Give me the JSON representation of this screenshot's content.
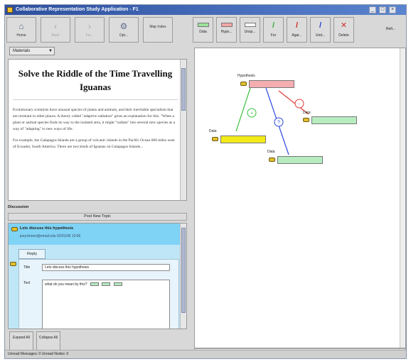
{
  "window": {
    "title": "Collaborative Representation Study Application - F1",
    "controls": {
      "minimize": "_",
      "maximize": "□",
      "close": "×"
    }
  },
  "toolbar": {
    "items": [
      {
        "label": "Home",
        "icon": "house-icon",
        "glyph": "⌂",
        "enabled": true
      },
      {
        "label": "Back",
        "icon": "back-arrow-icon",
        "glyph": "‹",
        "enabled": false
      },
      {
        "label": "Fw...",
        "icon": "forward-arrow-icon",
        "glyph": "›",
        "enabled": false
      },
      {
        "label": "Opt...",
        "icon": "options-icon",
        "glyph": "⚙",
        "enabled": true
      },
      {
        "label": "Map Index",
        "icon": "map-index-icon",
        "glyph": "",
        "enabled": true
      }
    ]
  },
  "selector": {
    "value": "Materials",
    "arrow": "▼"
  },
  "reading": {
    "title": "Solve the Riddle of the Time Travelling Iguanas",
    "paragraphs": [
      "Evolutionary scientists have unusual species of plants and animals, and their inevitable specialism that are resistant in other places. A theory called \"adaptive radiation\" gives an explanation for this. \"When a plant or animal species finds its way to the isolated area, it might \"radiate\" into several new species as a way of \"adapting\" to new ways of life.",
      "For example, the Galapagos Islands are a group of volcanic islands in the Pacific Ocean 600 miles west of Ecuador, South America. There are two kinds of Iguanas on Galapagos Islands..."
    ]
  },
  "discussion": {
    "label": "Discussion",
    "post_new": "Post New Topic",
    "message": {
      "title": "Lets discuss this hypothesis",
      "meta": "joey.brown@email.edu 02/01/06 10:56"
    },
    "reply_tab": "Reply",
    "title_label": "Title",
    "title_value": "Lets discuss this hypothesis",
    "text_label": "Text",
    "text_value": "what do you mean by this?",
    "expand": "Expand All",
    "collapse": "Collapse All"
  },
  "status": "Unread Messages: 0  Unread Nodes: 0",
  "graph_toolbar": {
    "items": [
      {
        "label": "Data",
        "swatch": "#9be39b",
        "icon": "data-node-icon"
      },
      {
        "label": "Hypo...",
        "swatch": "#f4a6a6",
        "icon": "hypothesis-node-icon"
      },
      {
        "label": "Unsp...",
        "swatch": "#ffffff",
        "icon": "unspecified-node-icon"
      },
      {
        "label": "For",
        "glyph": "/",
        "glyph_color": "#2eaa2e",
        "icon": "for-link-icon"
      },
      {
        "label": "Agai...",
        "glyph": "/",
        "glyph_color": "#d02020",
        "icon": "against-link-icon"
      },
      {
        "label": "Und...",
        "glyph": "/",
        "glyph_color": "#2040d0",
        "icon": "undetermined-link-icon"
      },
      {
        "label": "Delete",
        "glyph": "✕",
        "glyph_color": "#d03030",
        "icon": "delete-icon"
      }
    ],
    "extra": "Refr..."
  },
  "graph": {
    "nodes": [
      {
        "id": "hyp",
        "type": "Hypothesis",
        "fill": "#f5aeb0"
      },
      {
        "id": "data1",
        "type": "Data",
        "fill": "#f2ea18"
      },
      {
        "id": "data2",
        "type": "Data",
        "fill": "#b6ecc0"
      },
      {
        "id": "data3",
        "type": "Data",
        "fill": "#b6ecc0"
      }
    ],
    "links": [
      {
        "from": "hyp",
        "to": "data1",
        "symbol": "+",
        "color": "#38c038"
      },
      {
        "from": "hyp",
        "to": "data2",
        "symbol": "?",
        "color": "#2a48e0"
      },
      {
        "from": "hyp",
        "to": "data3",
        "symbol": "-",
        "color": "#e03a3a"
      }
    ]
  }
}
